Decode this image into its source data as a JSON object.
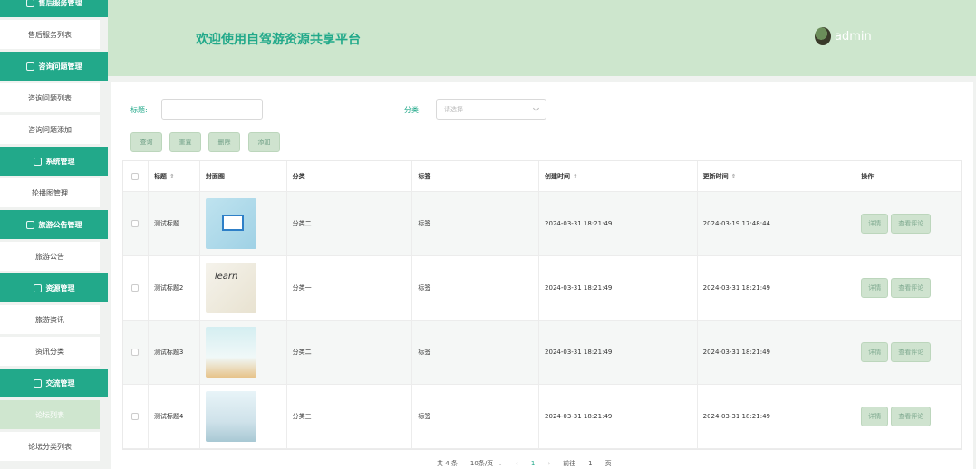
{
  "header": {
    "title": "欢迎使用自驾游资源共享平台",
    "username": "admin"
  },
  "sidebar": [
    {
      "type": "group",
      "label": "售后服务管理"
    },
    {
      "type": "item",
      "label": "售后服务列表"
    },
    {
      "type": "group",
      "label": "咨询问题管理"
    },
    {
      "type": "item",
      "label": "咨询问题列表"
    },
    {
      "type": "item",
      "label": "咨询问题添加"
    },
    {
      "type": "group",
      "label": "系统管理"
    },
    {
      "type": "item",
      "label": "轮播图管理"
    },
    {
      "type": "group",
      "label": "旅游公告管理"
    },
    {
      "type": "item",
      "label": "旅游公告"
    },
    {
      "type": "group",
      "label": "资源管理"
    },
    {
      "type": "item",
      "label": "旅游资讯"
    },
    {
      "type": "item",
      "label": "资讯分类"
    },
    {
      "type": "group",
      "label": "交流管理"
    },
    {
      "type": "item",
      "label": "论坛列表",
      "active": true
    },
    {
      "type": "item",
      "label": "论坛分类列表"
    }
  ],
  "search": {
    "title_label": "标题:",
    "title_value": "",
    "category_label": "分类:",
    "category_placeholder": "请选择"
  },
  "toolbar": {
    "query": "查询",
    "reset": "重置",
    "delete": "删除",
    "add": "添加"
  },
  "table": {
    "headers": {
      "title": "标题",
      "cover": "封面图",
      "category": "分类",
      "tag": "标签",
      "created": "创建时间",
      "updated": "更新时间",
      "actions": "操作"
    },
    "rows": [
      {
        "title": "测试标题",
        "category": "分类二",
        "tag": "标签",
        "created": "2024-03-31 18:21:49",
        "updated": "2024-03-19 17:48:44",
        "thumb": "t1"
      },
      {
        "title": "测试标题2",
        "category": "分类一",
        "tag": "标签",
        "created": "2024-03-31 18:21:49",
        "updated": "2024-03-31 18:21:49",
        "thumb": "t2"
      },
      {
        "title": "测试标题3",
        "category": "分类二",
        "tag": "标签",
        "created": "2024-03-31 18:21:49",
        "updated": "2024-03-31 18:21:49",
        "thumb": "t3"
      },
      {
        "title": "测试标题4",
        "category": "分类三",
        "tag": "标签",
        "created": "2024-03-31 18:21:49",
        "updated": "2024-03-31 18:21:49",
        "thumb": "t4"
      }
    ],
    "action_detail": "详情",
    "action_comments": "查看评论"
  },
  "pagination": {
    "total": "共 4 条",
    "page_size": "10条/页",
    "current": "1",
    "goto_prefix": "前往",
    "goto_value": "1",
    "goto_suffix": "页"
  }
}
